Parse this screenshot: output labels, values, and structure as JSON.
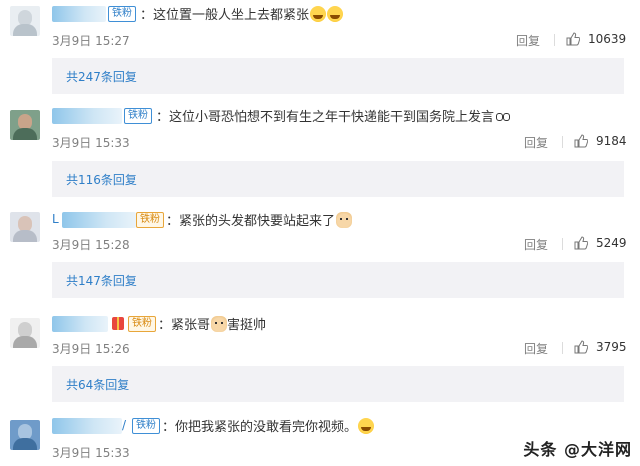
{
  "comments": [
    {
      "name_masked": "*",
      "badge": "铁粉",
      "badge_gold": false,
      "text": "：这位置一般人坐上去都紧张",
      "emoji": "laugh",
      "emoji_count": 2,
      "date": "3月9日 15:27",
      "reply_label": "回复",
      "likes": "10639",
      "thread_label": "共247条回复"
    },
    {
      "name_masked": "",
      "badge": "铁粉",
      "badge_gold": false,
      "text": "：这位小哥恐怕想不到有生之年干快递能干到国务院上发言",
      "emoji": "eyes",
      "emoji_count": 1,
      "date": "3月9日 15:33",
      "reply_label": "回复",
      "likes": "9184",
      "thread_label": "共116条回复"
    },
    {
      "name_masked": "L",
      "badge": "铁粉",
      "badge_gold": true,
      "text": "：紧张的头发都快要站起来了",
      "emoji": "dog",
      "emoji_count": 1,
      "date": "3月9日 15:28",
      "reply_label": "回复",
      "likes": "5249",
      "thread_label": "共147条回复"
    },
    {
      "name_masked": "",
      "badge": "铁粉",
      "badge_gold": true,
      "text_before": "：紧张哥",
      "text_after": "害挺帅",
      "emoji": "dog",
      "date": "3月9日 15:26",
      "reply_label": "回复",
      "likes": "3795",
      "thread_label": "共64条回复"
    },
    {
      "name_masked": "/",
      "badge": "铁粉",
      "badge_gold": false,
      "text": "：你把我紧张的没敢看完你视频。",
      "emoji": "laugh",
      "emoji_count": 1,
      "date": "3月9日 15:33"
    }
  ],
  "watermark": "头条 @大洋网",
  "colors": {
    "link": "#2f7fc8",
    "thread_bg": "#f2f2f5",
    "meta": "#808080"
  }
}
